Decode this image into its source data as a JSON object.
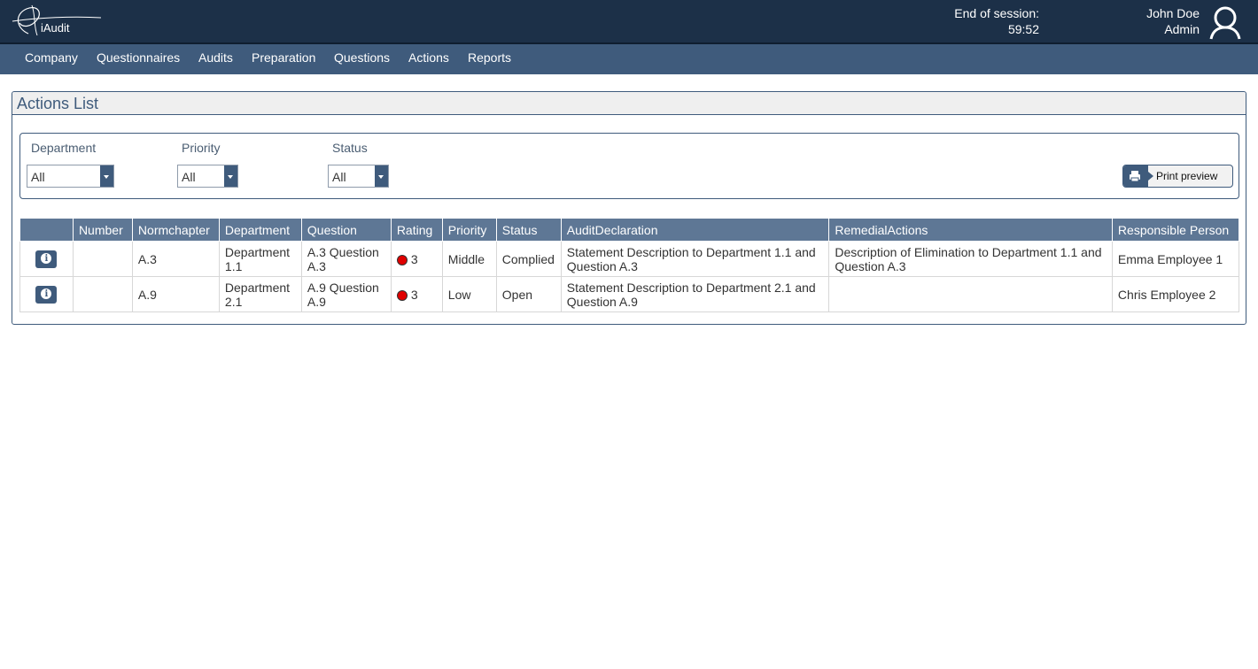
{
  "header": {
    "logo_text": "iAudit",
    "session_label": "End of session:",
    "session_time": "59:52",
    "user_name": "John Doe",
    "user_role": "Admin"
  },
  "nav": {
    "items": [
      "Company",
      "Questionnaires",
      "Audits",
      "Preparation",
      "Questions",
      "Actions",
      "Reports"
    ]
  },
  "panel": {
    "title": "Actions List"
  },
  "filters": {
    "department": {
      "label": "Department",
      "value": "All"
    },
    "priority": {
      "label": "Priority",
      "value": "All"
    },
    "status": {
      "label": "Status",
      "value": "All"
    }
  },
  "toolbar": {
    "print_label": "Print preview"
  },
  "table": {
    "columns": [
      "",
      "Number",
      "Normchapter",
      "Department",
      "Question",
      "Rating",
      "Priority",
      "Status",
      "AuditDeclaration",
      "RemedialActions",
      "Responsible Person"
    ],
    "rows": [
      {
        "number": "",
        "normchapter": "A.3",
        "department": "Department 1.1",
        "question": "A.3 Question A.3",
        "rating": "3",
        "rating_color": "#e00000",
        "priority": "Middle",
        "status": "Complied",
        "audit_declaration": "Statement Description to Department 1.1 and Question A.3",
        "remedial_actions": "Description of Elimination to Department 1.1 and Question A.3",
        "responsible": "Emma Employee 1"
      },
      {
        "number": "",
        "normchapter": "A.9",
        "department": "Department 2.1",
        "question": "A.9 Question A.9",
        "rating": "3",
        "rating_color": "#e00000",
        "priority": "Low",
        "status": "Open",
        "audit_declaration": "Statement Description to Department 2.1 and Question A.9",
        "remedial_actions": "",
        "responsible": "Chris Employee 2"
      }
    ]
  },
  "colors": {
    "header_bg": "#1c3048",
    "nav_bg": "#3f5b7c",
    "table_header_bg": "#5e7795",
    "rating_red": "#e00000"
  }
}
